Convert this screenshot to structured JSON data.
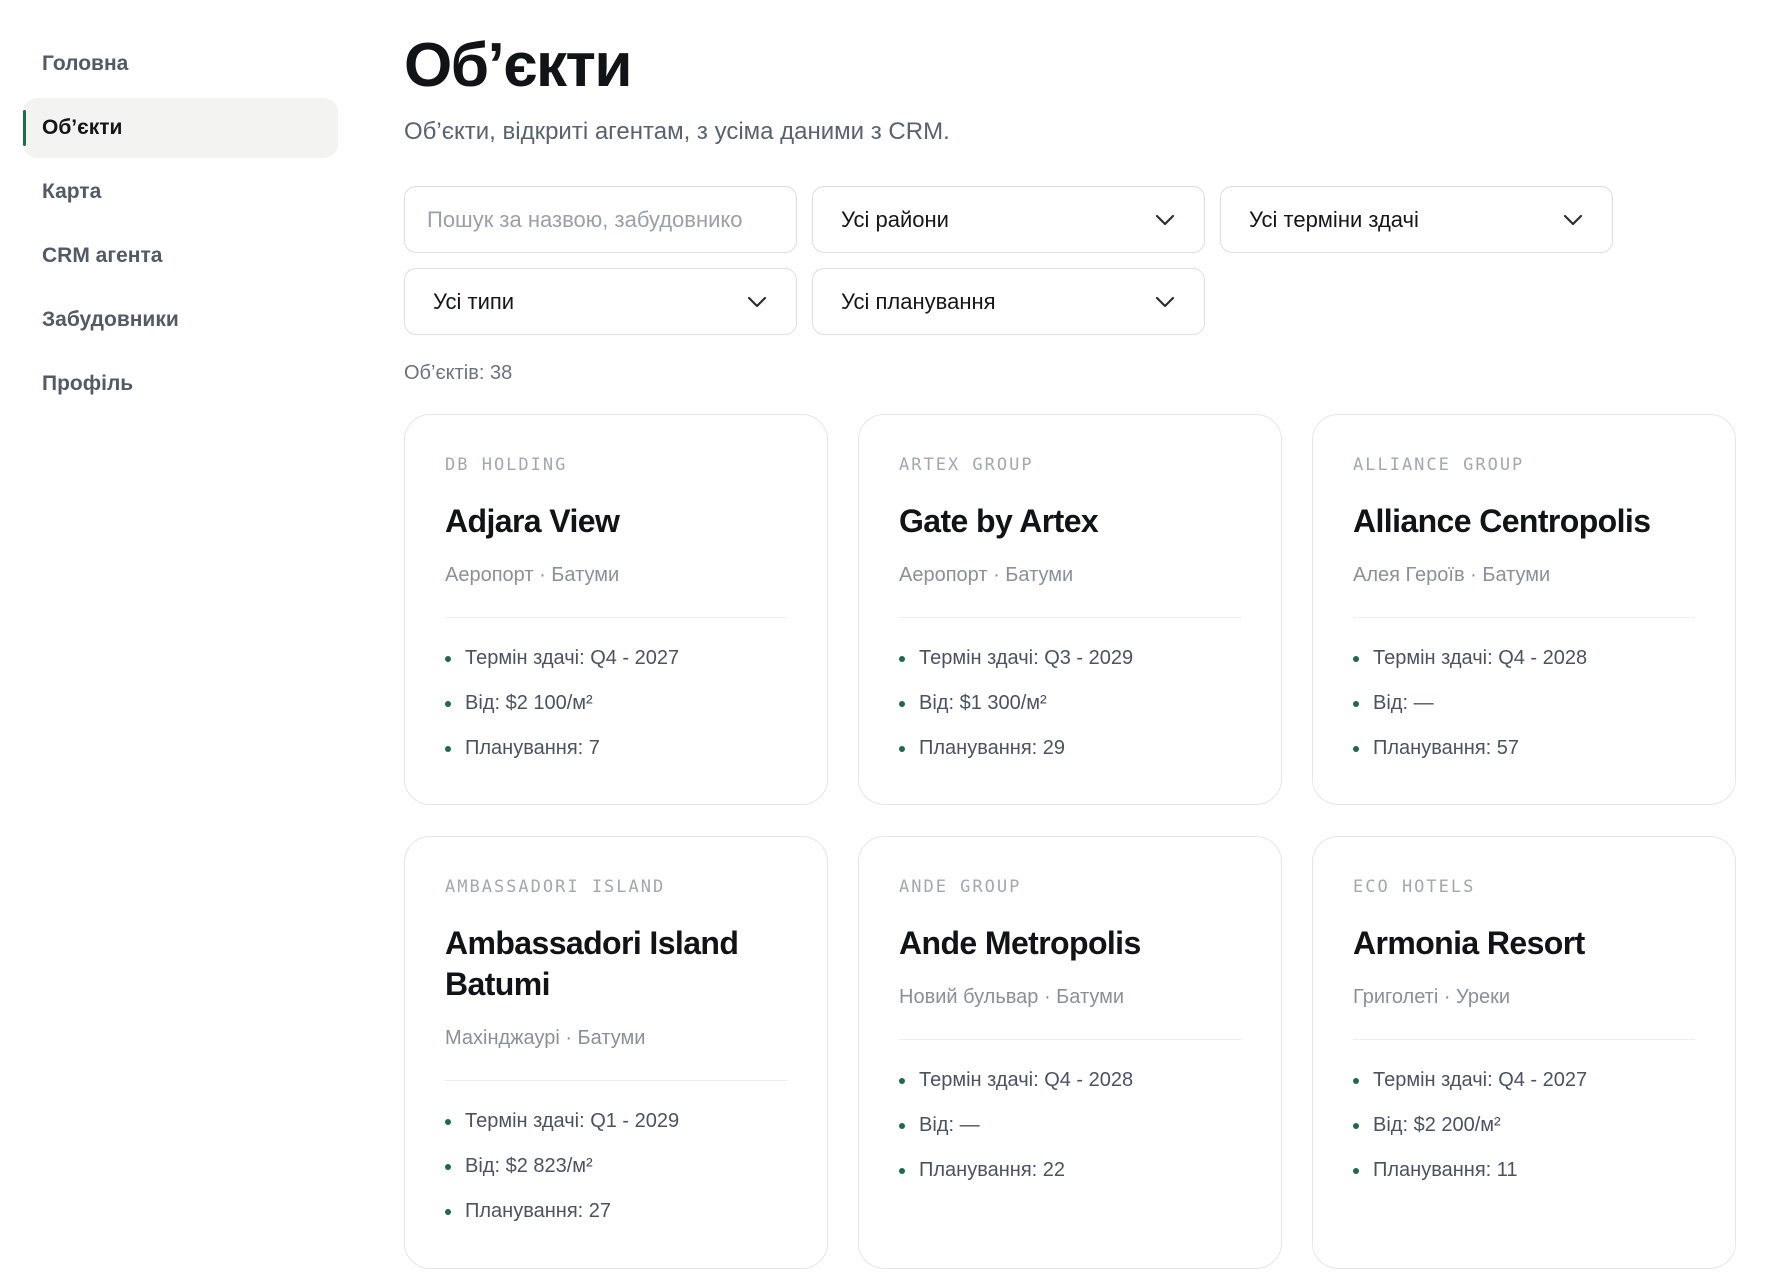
{
  "sidebar": {
    "items": [
      {
        "label": "Головна",
        "active": false
      },
      {
        "label": "Об’єкти",
        "active": true
      },
      {
        "label": "Карта",
        "active": false
      },
      {
        "label": "CRM агента",
        "active": false
      },
      {
        "label": "Забудовники",
        "active": false
      },
      {
        "label": "Профіль",
        "active": false
      }
    ]
  },
  "header": {
    "title": "Об’єкти",
    "subtitle": "Об’єкти, відкриті агентам, з усіма даними з CRM."
  },
  "filters": {
    "search_placeholder": "Пошук за назвою, забудовнико",
    "search_value": "",
    "district": "Усі райони",
    "deadline": "Усі терміни здачі",
    "type": "Усі типи",
    "layout": "Усі планування",
    "chevron_icon": "chevron-down-icon"
  },
  "count_text": "Об’єктів: 38",
  "accent_color": "#1f6b47",
  "cards": [
    {
      "developer": "DB HOLDING",
      "name": "Adjara View",
      "location": "Аеропорт · Батуми",
      "deadline": "Термін здачі: Q4 - 2027",
      "price": "Від: $2 100/м²",
      "layouts": "Планування: 7"
    },
    {
      "developer": "ARTEX GROUP",
      "name": "Gate by Artex",
      "location": "Аеропорт · Батуми",
      "deadline": "Термін здачі: Q3 - 2029",
      "price": "Від: $1 300/м²",
      "layouts": "Планування: 29"
    },
    {
      "developer": "ALLIANCE GROUP",
      "name": "Alliance Centropolis",
      "location": "Алея Героїв · Батуми",
      "deadline": "Термін здачі: Q4 - 2028",
      "price": "Від: —",
      "layouts": "Планування: 57"
    },
    {
      "developer": "AMBASSADORI ISLAND",
      "name": "Ambassadori Island Batumi",
      "location": "Махінджаурі · Батуми",
      "deadline": "Термін здачі: Q1 - 2029",
      "price": "Від: $2 823/м²",
      "layouts": "Планування: 27"
    },
    {
      "developer": "ANDE GROUP",
      "name": "Ande Metropolis",
      "location": "Новий бульвар · Батуми",
      "deadline": "Термін здачі: Q4 - 2028",
      "price": "Від: —",
      "layouts": "Планування: 22"
    },
    {
      "developer": "ECO HOTELS",
      "name": "Armonia Resort",
      "location": "Григолеті · Уреки",
      "deadline": "Термін здачі: Q4 - 2027",
      "price": "Від: $2 200/м²",
      "layouts": "Планування: 11"
    }
  ]
}
